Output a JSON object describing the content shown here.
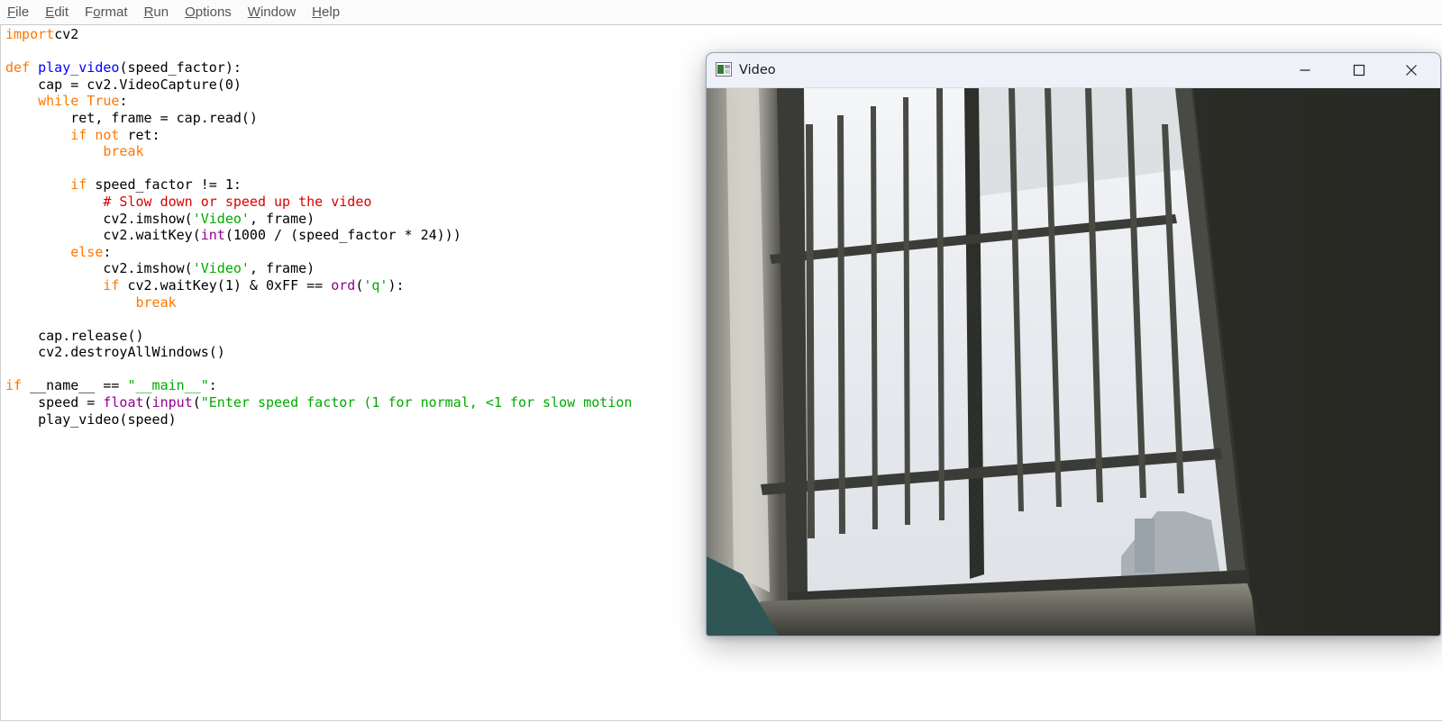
{
  "menubar": {
    "items": [
      {
        "label": "File",
        "accel": "F",
        "rest": "ile"
      },
      {
        "label": "Edit",
        "accel": "E",
        "rest": "dit"
      },
      {
        "label": "Format",
        "pre": "F",
        "accel": "o",
        "rest": "rmat"
      },
      {
        "label": "Run",
        "accel": "R",
        "rest": "un"
      },
      {
        "label": "Options",
        "accel": "O",
        "rest": "ptions"
      },
      {
        "label": "Window",
        "accel": "W",
        "rest": "indow"
      },
      {
        "label": "Help",
        "accel": "H",
        "rest": "elp"
      }
    ]
  },
  "editor": {
    "lines": [
      [
        [
          "kw",
          "import"
        ],
        [
          "",
          "cv2"
        ]
      ],
      [],
      [
        [
          "kw",
          "def"
        ],
        [
          "",
          " "
        ],
        [
          "fn",
          "play_video"
        ],
        [
          "",
          "(speed_factor):"
        ]
      ],
      [
        [
          "",
          "    cap = cv2.VideoCapture(0)"
        ]
      ],
      [
        [
          "",
          "    "
        ],
        [
          "kw",
          "while True"
        ],
        [
          "",
          ":"
        ]
      ],
      [
        [
          "",
          "        ret, frame = cap.read()"
        ]
      ],
      [
        [
          "",
          "        "
        ],
        [
          "kw",
          "if not"
        ],
        [
          "",
          " ret:"
        ]
      ],
      [
        [
          "",
          "            "
        ],
        [
          "kw",
          "break"
        ]
      ],
      [],
      [
        [
          "",
          "        "
        ],
        [
          "kw",
          "if"
        ],
        [
          "",
          " speed_factor != 1:"
        ]
      ],
      [
        [
          "",
          "            "
        ],
        [
          "cm",
          "# Slow down or speed up the video"
        ]
      ],
      [
        [
          "",
          "            cv2.imshow("
        ],
        [
          "str",
          "'Video'"
        ],
        [
          "",
          ", frame)"
        ]
      ],
      [
        [
          "",
          "            cv2.waitKey("
        ],
        [
          "bi",
          "int"
        ],
        [
          "",
          "(1000 / (speed_factor * 24)))"
        ]
      ],
      [
        [
          "",
          "        "
        ],
        [
          "kw",
          "else"
        ],
        [
          "",
          ":"
        ]
      ],
      [
        [
          "",
          "            cv2.imshow("
        ],
        [
          "str",
          "'Video'"
        ],
        [
          "",
          ", frame)"
        ]
      ],
      [
        [
          "",
          "            "
        ],
        [
          "kw",
          "if"
        ],
        [
          "",
          " cv2.waitKey(1) & 0xFF == "
        ],
        [
          "bi",
          "ord"
        ],
        [
          "",
          "("
        ],
        [
          "str",
          "'q'"
        ],
        [
          "",
          "):"
        ]
      ],
      [
        [
          "",
          "                "
        ],
        [
          "kw",
          "break"
        ]
      ],
      [],
      [
        [
          "",
          "    cap.release()"
        ]
      ],
      [
        [
          "",
          "    cv2.destroyAllWindows()"
        ]
      ],
      [],
      [
        [
          "kw",
          "if"
        ],
        [
          "",
          " __name__ == "
        ],
        [
          "str",
          "\"__main__\""
        ],
        [
          "",
          ":"
        ]
      ],
      [
        [
          "",
          "    speed = "
        ],
        [
          "bi",
          "float"
        ],
        [
          "",
          "("
        ],
        [
          "bi",
          "input"
        ],
        [
          "",
          "("
        ],
        [
          "str",
          "\"Enter speed factor (1 for normal, <1 for slow motion"
        ]
      ],
      [
        [
          "",
          "    play_video(speed)"
        ]
      ]
    ]
  },
  "video_window": {
    "title": "Video",
    "icon": "window-app-icon",
    "controls": [
      "minimize-icon",
      "maximize-icon",
      "close-icon"
    ]
  },
  "colors": {
    "keyword": "#ff7700",
    "definition": "#0000ff",
    "builtin": "#900090",
    "string": "#00aa00",
    "comment": "#dd0000"
  }
}
